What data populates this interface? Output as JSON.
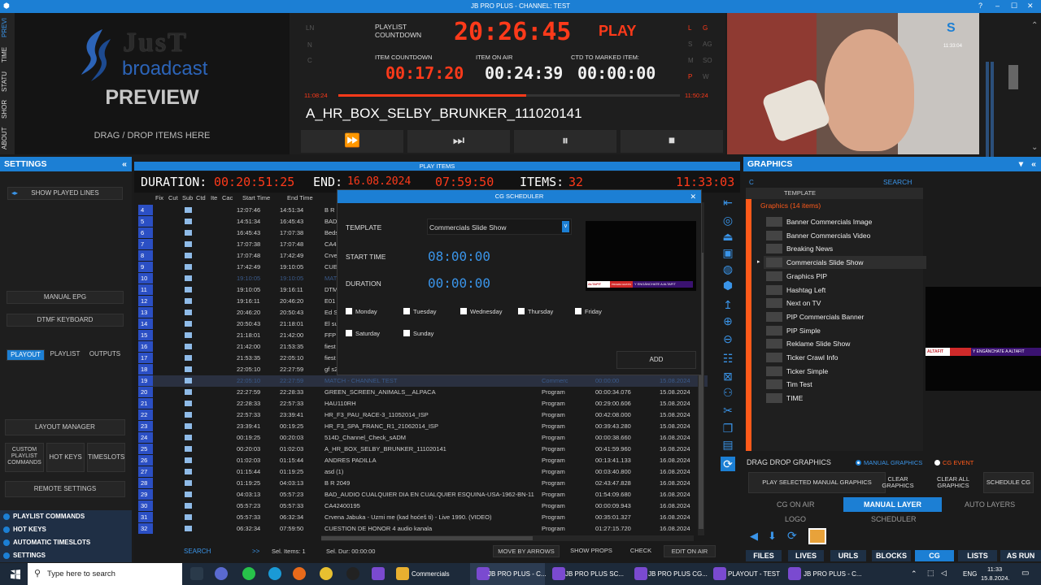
{
  "window": {
    "title": "JB PRO PLUS - CHANNEL: TEST",
    "help": "?",
    "min": "–",
    "max": "☐",
    "close": "✕"
  },
  "vtabs": [
    "PREVI",
    "TIME",
    "STATU",
    "SHOR",
    "ABOUT"
  ],
  "preview": {
    "logo_just": "JusT",
    "logo_broadcast": "broadcast",
    "label": "PREVIEW",
    "drag": "DRAG / DROP ITEMS HERE"
  },
  "countdown": {
    "playlist_label": "PLAYLIST COUNTDOWN",
    "playlist_value": "20:26:45",
    "play": "PLAY",
    "item_countdown_label": "ITEM COUNTDOWN",
    "item_countdown": "00:17:20",
    "item_on_air_label": "ITEM ON AIR",
    "item_on_air": "00:24:39",
    "ctd_marked_label": "CTD TO MARKED ITEM:",
    "ctd_marked": "00:00:00",
    "left_time": "11:08:24",
    "right_time": "11:50:24",
    "progress": 0.55,
    "item_name": "A_HR_BOX_SELBY_BRUNKER_111020141",
    "left_letters": [
      "LN",
      "N",
      "C"
    ],
    "right_letters": [
      "L",
      "G",
      "S",
      "AG",
      "M",
      "SO",
      "P",
      "W"
    ]
  },
  "transport": {
    "ff": "⏩",
    "skip": "⏭",
    "pause": "⏸",
    "stop": "⏹"
  },
  "video": {
    "timecode": "11:33:04"
  },
  "settings": {
    "title": "SETTINGS",
    "show_played": "SHOW PLAYED LINES",
    "manual_epg": "MANUAL EPG",
    "dtmf": "DTMF KEYBOARD",
    "tabs": [
      "PLAYOUT",
      "PLAYLIST",
      "OUTPUTS"
    ],
    "layout_manager": "LAYOUT MANAGER",
    "custom_cmds": "CUSTOM PLAYLIST COMMANDS",
    "hot_keys": "HOT KEYS",
    "timeslots": "TIMESLOTS",
    "remote": "REMOTE SETTINGS",
    "bottom": [
      "PLAYLIST COMMANDS",
      "HOT KEYS",
      "AUTOMATIC TIMESLOTS",
      "SETTINGS"
    ]
  },
  "playlist": {
    "header": "PLAY ITEMS",
    "duration_label": "DURATION:",
    "duration": "00:20:51:25",
    "end_label": "END:",
    "end_date": "16.08.2024",
    "end_time": "07:59:50",
    "items_label": "ITEMS:",
    "items": "32",
    "clock": "11:33:03",
    "columns": [
      "Fix",
      "Cut",
      "Sub",
      "Ctd",
      "Ite",
      "Cac",
      "Start Time",
      "End Time"
    ],
    "rows": [
      {
        "n": "4",
        "start": "12:07:46",
        "end": "14:51:34",
        "name": "B R",
        "type": "",
        "dur": "",
        "date": ""
      },
      {
        "n": "5",
        "start": "14:51:34",
        "end": "16:45:43",
        "name": "BAD",
        "type": "",
        "dur": "",
        "date": ""
      },
      {
        "n": "6",
        "start": "16:45:43",
        "end": "17:07:38",
        "name": "Beds",
        "type": "",
        "dur": "",
        "date": ""
      },
      {
        "n": "7",
        "start": "17:07:38",
        "end": "17:07:48",
        "name": "CA4",
        "type": "",
        "dur": "",
        "date": ""
      },
      {
        "n": "8",
        "start": "17:07:48",
        "end": "17:42:49",
        "name": "Crve",
        "type": "",
        "dur": "",
        "date": ""
      },
      {
        "n": "9",
        "start": "17:42:49",
        "end": "19:10:05",
        "name": "CUE",
        "type": "",
        "dur": "",
        "date": ""
      },
      {
        "n": "10",
        "start": "19:10:05",
        "end": "19:10:05",
        "name": "MAT",
        "type": "",
        "dur": "",
        "date": ""
      },
      {
        "n": "11",
        "start": "19:10:05",
        "end": "19:16:11",
        "name": "DTM",
        "type": "",
        "dur": "",
        "date": ""
      },
      {
        "n": "12",
        "start": "19:16:11",
        "end": "20:46:20",
        "name": "E01",
        "type": "",
        "dur": "",
        "date": ""
      },
      {
        "n": "13",
        "start": "20:46:20",
        "end": "20:50:43",
        "name": "Ed S",
        "type": "",
        "dur": "",
        "date": ""
      },
      {
        "n": "14",
        "start": "20:50:43",
        "end": "21:18:01",
        "name": "El su",
        "type": "",
        "dur": "",
        "date": ""
      },
      {
        "n": "15",
        "start": "21:18:01",
        "end": "21:42:00",
        "name": "FFP",
        "type": "",
        "dur": "",
        "date": ""
      },
      {
        "n": "16",
        "start": "21:42:00",
        "end": "21:53:35",
        "name": "fiest",
        "type": "",
        "dur": "",
        "date": ""
      },
      {
        "n": "17",
        "start": "21:53:35",
        "end": "22:05:10",
        "name": "fiest",
        "type": "",
        "dur": "",
        "date": ""
      },
      {
        "n": "18",
        "start": "22:05:10",
        "end": "22:27:59",
        "name": "gf s2",
        "type": "",
        "dur": "",
        "date": ""
      },
      {
        "n": "19",
        "start": "22:05:10",
        "end": "22:27:59",
        "name": "MATCH - CHANNEL TEST",
        "type": "Commerc",
        "dur": "00:00:00",
        "date": "15.08.2024"
      },
      {
        "n": "20",
        "start": "22:27:59",
        "end": "22:28:33",
        "name": "GREEN_SCREEN_ANIMALS__ALPACA",
        "type": "Program",
        "dur": "00:00:34.076",
        "date": "15.08.2024"
      },
      {
        "n": "21",
        "start": "22:28:33",
        "end": "22:57:33",
        "name": "HAU110RH",
        "type": "Program",
        "dur": "00:29:00.606",
        "date": "15.08.2024"
      },
      {
        "n": "22",
        "start": "22:57:33",
        "end": "23:39:41",
        "name": "HR_F3_PAU_RACE-3_11052014_ISP",
        "type": "Program",
        "dur": "00:42:08.000",
        "date": "15.08.2024"
      },
      {
        "n": "23",
        "start": "23:39:41",
        "end": "00:19:25",
        "name": "HR_F3_SPA_FRANC_R1_21062014_ISP",
        "type": "Program",
        "dur": "00:39:43.280",
        "date": "15.08.2024"
      },
      {
        "n": "24",
        "start": "00:19:25",
        "end": "00:20:03",
        "name": "514D_Channel_Check_sADM",
        "type": "Program",
        "dur": "00:00:38.660",
        "date": "16.08.2024"
      },
      {
        "n": "25",
        "start": "00:20:03",
        "end": "01:02:03",
        "name": "A_HR_BOX_SELBY_BRUNKER_111020141",
        "type": "Program",
        "dur": "00:41:59.960",
        "date": "16.08.2024"
      },
      {
        "n": "26",
        "start": "01:02:03",
        "end": "01:15:44",
        "name": "ANDRES PADILLA",
        "type": "Program",
        "dur": "00:13:41.133",
        "date": "16.08.2024"
      },
      {
        "n": "27",
        "start": "01:15:44",
        "end": "01:19:25",
        "name": "asd (1)",
        "type": "Program",
        "dur": "00:03:40.800",
        "date": "16.08.2024"
      },
      {
        "n": "28",
        "start": "01:19:25",
        "end": "04:03:13",
        "name": "B R 2049",
        "type": "Program",
        "dur": "02:43:47.828",
        "date": "16.08.2024"
      },
      {
        "n": "29",
        "start": "04:03:13",
        "end": "05:57:23",
        "name": "BAD_AUDIO CUALQUIER DIA EN CUALQUIER ESQUINA-USA-1962-BN-11",
        "type": "Program",
        "dur": "01:54:09.680",
        "date": "16.08.2024"
      },
      {
        "n": "30",
        "start": "05:57:23",
        "end": "05:57:33",
        "name": "CA42400195",
        "type": "Program",
        "dur": "00:00:09.943",
        "date": "16.08.2024"
      },
      {
        "n": "31",
        "start": "05:57:33",
        "end": "06:32:34",
        "name": "Crvena Jabuka - Uzmi me (kad hoćeš ti) - Live 1990. (VIDEO)",
        "type": "Program",
        "dur": "00:35:01.327",
        "date": "16.08.2024"
      },
      {
        "n": "32",
        "start": "06:32:34",
        "end": "07:59:50",
        "name": "CUESTION DE HONOR 4 audio kanala",
        "type": "Program",
        "dur": "01:27:15.720",
        "date": "16.08.2024"
      }
    ],
    "footer": {
      "search": "SEARCH",
      "arrows": ">>",
      "sel_items": "Sel. Items: 1",
      "sel_dur": "Sel. Dur: 00:00:00",
      "move": "MOVE BY ARROWS",
      "show_props": "SHOW PROPS",
      "check": "CHECK",
      "edit": "EDIT ON AIR"
    }
  },
  "dialog": {
    "title": "CG SCHEDULER",
    "close": "✕",
    "template_label": "TEMPLATE",
    "template_value": "Commercials Slide Show",
    "start_label": "START TIME",
    "start_value": "08:00:00",
    "duration_label": "DURATION",
    "duration_value": "00:00:00",
    "days": [
      "Monday",
      "Tuesday",
      "Wednesday",
      "Thursday",
      "Friday",
      "Saturday",
      "Sunday"
    ],
    "add": "ADD",
    "thumb_left": "ALTAFIT",
    "thumb_mid": "PRUEBA GRATIS",
    "thumb_right": "Y ENGÁNCHATE A ALTAFIT"
  },
  "graphics": {
    "title": "GRAPHICS",
    "c": "C",
    "search": "SEARCH",
    "template_header": "TEMPLATE",
    "group": "Graphics (14 items)",
    "items": [
      "Banner Commercials Image",
      "Banner Commercials Video",
      "Breaking News",
      "Commercials Slide Show",
      "Graphics PIP",
      "Hashtag Left",
      "Next on TV",
      "PIP Commercials Banner",
      "PIP Simple",
      "Reklame Slide Show",
      "Ticker Crawl Info",
      "Ticker Simple",
      "Tim Test",
      "TIME"
    ],
    "selected": 3,
    "preview_left": "ALTAFIT",
    "preview_right": "Y ENGÁNCHATE A ALTAFIT",
    "drag": "DRAG DROP GRAPHICS",
    "manual": "MANUAL GRAPHICS",
    "cg_event": "CG EVENT",
    "play_selected": "PLAY SELECTED MANUAL GRAPHICS",
    "clear": "CLEAR GRAPHICS",
    "clear_all": "CLEAR ALL GRAPHICS",
    "schedule": "SCHEDULE CG",
    "cg_on_air": "CG ON AIR",
    "manual_layer": "MANUAL LAYER",
    "auto_layers": "AUTO LAYERS",
    "logo": "LOGO",
    "scheduler": "SCHEDULER",
    "tabs": [
      "FILES",
      "LIVES",
      "URLS",
      "BLOCKS",
      "CG",
      "LISTS",
      "AS RUN"
    ]
  },
  "taskbar": {
    "search": "Type here to search",
    "apps": [
      "Commercials",
      "JB PRO PLUS - C...",
      "JB PRO PLUS SC...",
      "JB PRO PLUS CG...",
      "PLAYOUT - TEST",
      "JB PRO PLUS - C..."
    ],
    "lang": "ENG",
    "time": "11:33",
    "date": "15.8.2024."
  },
  "colors": {
    "accent": "#1c7fd4",
    "segment_red": "#ff3a1a",
    "row_blue": "#2b4fc4",
    "orange": "#ff5a1a"
  }
}
